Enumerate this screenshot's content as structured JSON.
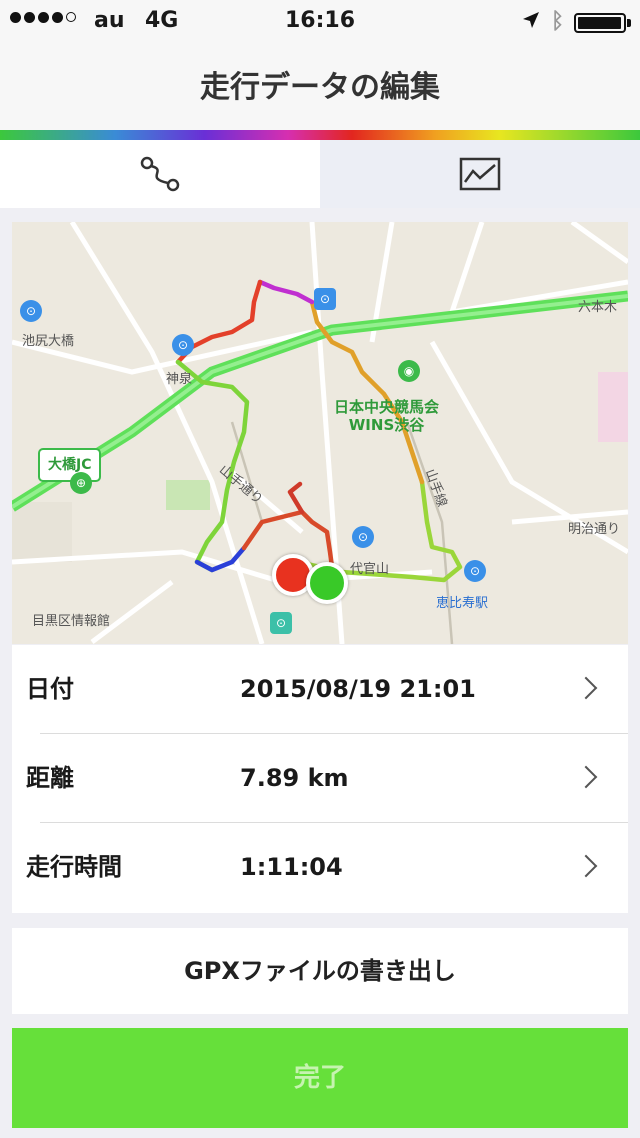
{
  "status_bar": {
    "carrier": "au",
    "network": "4G",
    "time": "16:16"
  },
  "nav": {
    "title": "走行データの編集"
  },
  "tabs": [
    {
      "name": "route",
      "icon": "route-icon",
      "active": true
    },
    {
      "name": "graph",
      "icon": "line-chart-icon",
      "active": false
    }
  ],
  "map": {
    "labels": {
      "roppongi": "六本木",
      "ikejiri": "池尻大橋",
      "shinsen": "神泉",
      "jra_line1": "日本中央競馬会",
      "jra_line2": "WINS渋谷",
      "ohashi_jc": "大橋JC",
      "yamate_dori": "山手通り",
      "meiji_dori": "明治通り",
      "yamanote_line": "山手線",
      "daikanyama": "代官山",
      "ebisu": "恵比寿駅",
      "meguro_info": "目黒区情報館"
    }
  },
  "details": [
    {
      "label": "日付",
      "value": "2015/08/19 21:01"
    },
    {
      "label": "距離",
      "value": "7.89 km"
    },
    {
      "label": "走行時間",
      "value": "1:11:04"
    }
  ],
  "actions": {
    "export_gpx": "GPXファイルの書き出し",
    "done": "完了"
  },
  "colors": {
    "accent_green": "#66e03a",
    "start_marker": "#e8321f",
    "end_marker": "#39c928"
  }
}
